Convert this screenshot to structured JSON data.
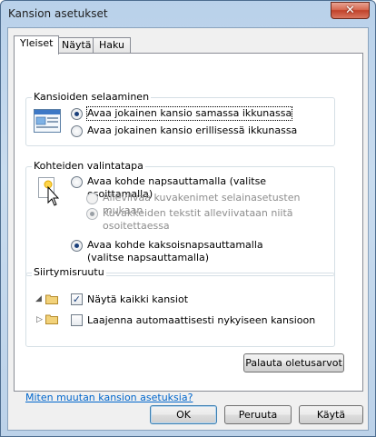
{
  "window": {
    "title": "Kansion asetukset",
    "close_glyph": "✕"
  },
  "tabs": [
    {
      "label": "Yleiset",
      "active": true
    },
    {
      "label": "Näytä",
      "active": false
    },
    {
      "label": "Haku",
      "active": false
    }
  ],
  "browse_folders": {
    "title": "Kansioiden selaaminen",
    "options": [
      {
        "label": "Avaa jokainen kansio samassa ikkunassa",
        "checked": true
      },
      {
        "label": "Avaa jokainen kansio erillisessä ikkunassa",
        "checked": false
      }
    ]
  },
  "click_items": {
    "title": "Kohteiden valintatapa",
    "single_click": "Avaa kohde napsauttamalla (valitse osoittamalla)",
    "underline_browser": "Alleviivaa kuvakenimet selainasetusten mukaan",
    "underline_point": "Kuvakkeiden tekstit alleviivataan niitä osoitettaessa",
    "double_click": "Avaa kohde kaksoisnapsauttamalla (valitse napsauttamalla)"
  },
  "navigation_pane": {
    "title": "Siirtymisruutu",
    "show_all": {
      "label": "Näytä kaikki kansiot",
      "checked": true
    },
    "auto_expand": {
      "label": "Laajenna automaattisesti nykyiseen kansioon",
      "checked": false
    }
  },
  "restore_defaults": "Palauta oletusarvot",
  "help_link": "Miten muutan kansion asetuksia?",
  "buttons": {
    "ok": "OK",
    "cancel": "Peruuta",
    "apply": "Käytä"
  }
}
